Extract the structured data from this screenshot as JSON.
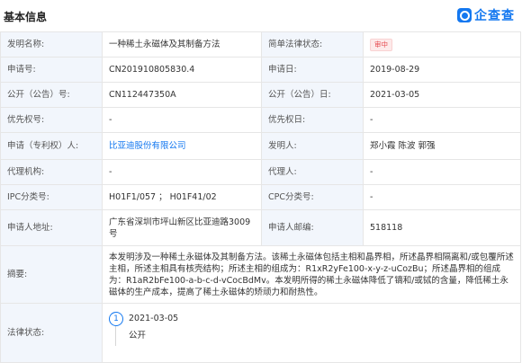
{
  "header": {
    "section_title": "基本信息",
    "logo_text": "企查查"
  },
  "rows": {
    "invention_name": {
      "label": "发明名称:",
      "value": "一种稀土永磁体及其制备方法"
    },
    "legal_status_brief": {
      "label": "简单法律状态:",
      "value": "审中"
    },
    "application_no": {
      "label": "申请号:",
      "value": "CN201910805830.4"
    },
    "application_date": {
      "label": "申请日:",
      "value": "2019-08-29"
    },
    "publication_no": {
      "label": "公开（公告）号:",
      "value": "CN112447350A"
    },
    "publication_date": {
      "label": "公开（公告）日:",
      "value": "2021-03-05"
    },
    "priority_no": {
      "label": "优先权号:",
      "value": "-"
    },
    "priority_date": {
      "label": "优先权日:",
      "value": "-"
    },
    "applicant": {
      "label": "申请（专利权）人:",
      "value": "比亚迪股份有限公司"
    },
    "inventor": {
      "label": "发明人:",
      "value": "郑小霞 陈波 郭强"
    },
    "agency": {
      "label": "代理机构:",
      "value": "-"
    },
    "agent": {
      "label": "代理人:",
      "value": "-"
    },
    "ipc": {
      "label": "IPC分类号:",
      "value": "H01F1/057 ； H01F41/02"
    },
    "cpc": {
      "label": "CPC分类号:",
      "value": "-"
    },
    "applicant_address": {
      "label": "申请人地址:",
      "value": "广东省深圳市坪山新区比亚迪路3009号"
    },
    "postal_code": {
      "label": "申请人邮编:",
      "value": "518118"
    },
    "abstract": {
      "label": "摘要:",
      "value": "本发明涉及一种稀土永磁体及其制备方法。该稀土永磁体包括主相和晶界相，所述晶界相隔离和/或包覆所述主相，所述主相具有核壳结构；所述主相的组成为：R1xR2yFe100-x-y-z-uCozBu；所述晶界相的组成为：R1aR2bFe100-a-b-c-d-vCocBdMv。本发明所得的稀土永磁体降低了镝和/或铽的含量，降低稀土永磁体的生产成本，提高了稀土永磁体的矫顽力和耐热性。"
    },
    "legal_status": {
      "label": "法律状态:",
      "events": [
        {
          "index": "1",
          "date": "2021-03-05",
          "event": "公开"
        }
      ]
    }
  },
  "colors": {
    "accent": "#1478f0",
    "label_bg": "#f2f6fc",
    "border": "#e6e6e6",
    "badge_text": "#e5484d",
    "badge_bg": "#fdeaea"
  }
}
